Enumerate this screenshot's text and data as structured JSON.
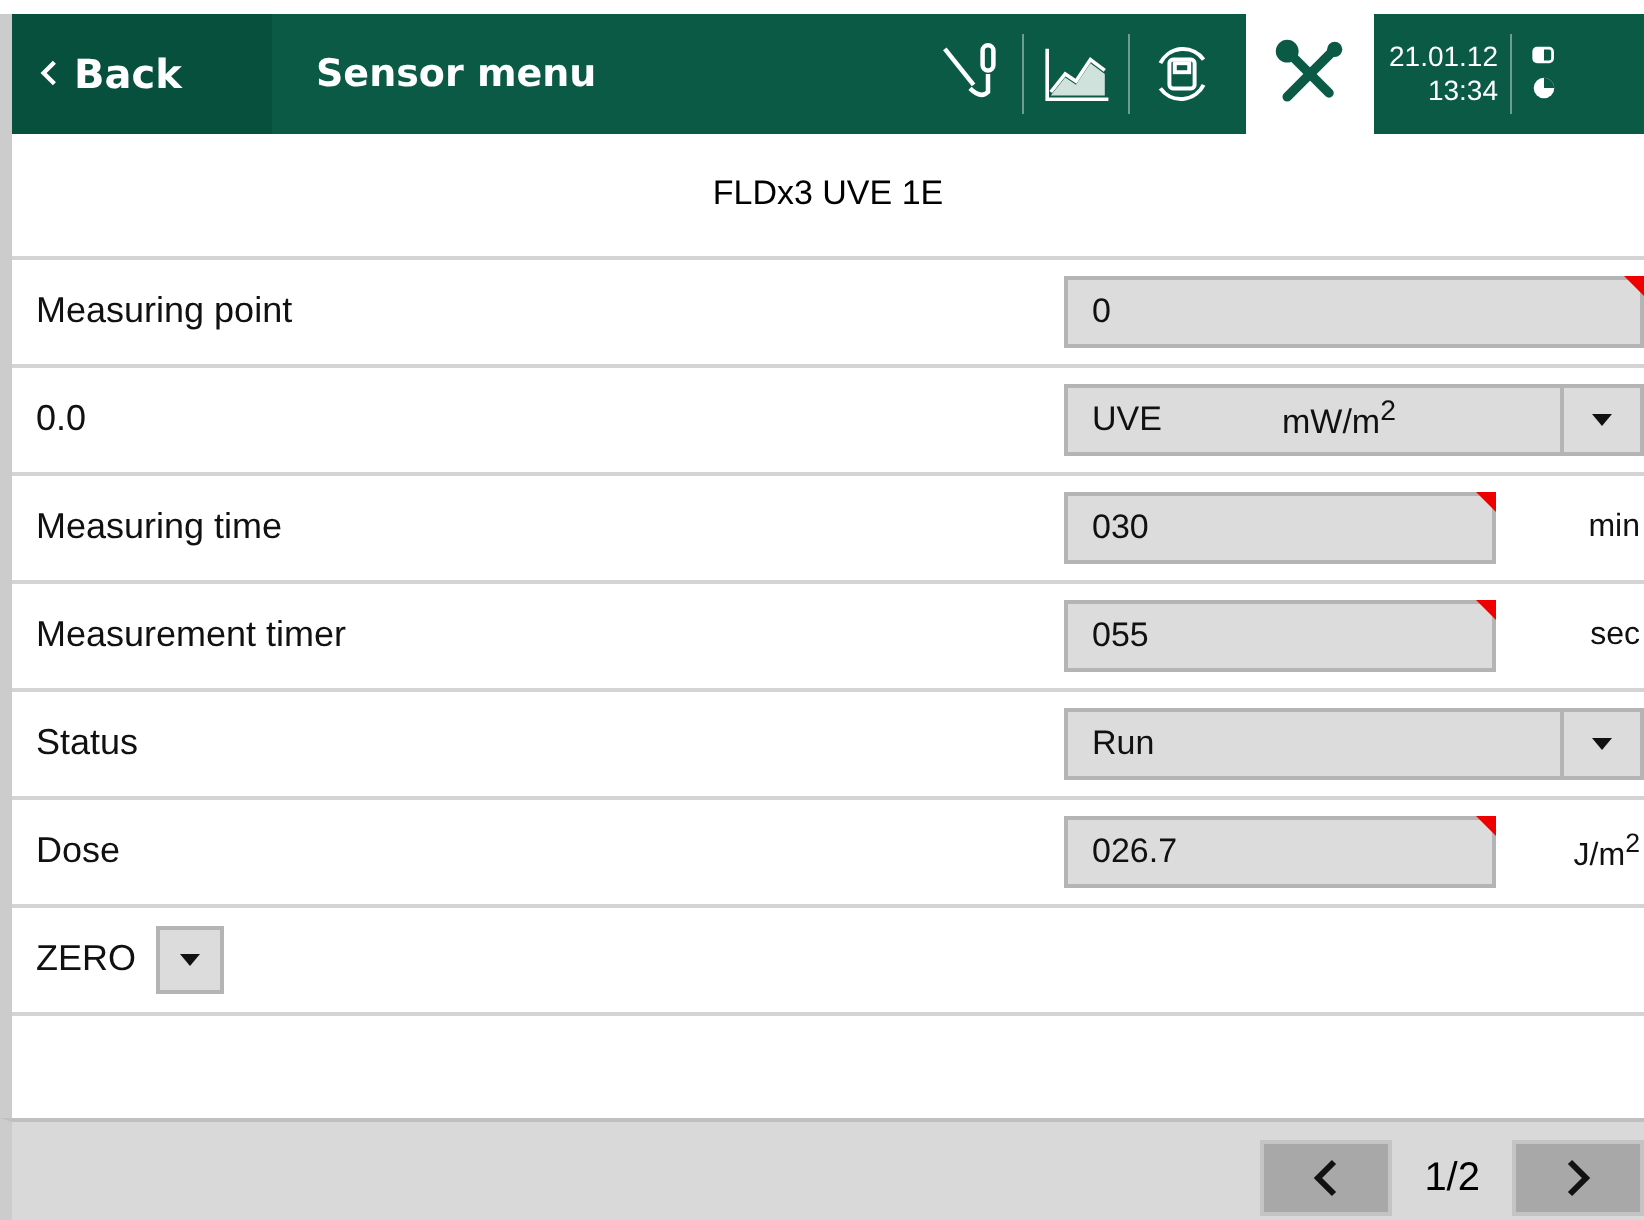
{
  "header": {
    "back": "Back",
    "title": "Sensor menu",
    "tools": [
      {
        "kind": "sensor",
        "selected": false
      },
      {
        "kind": "chart",
        "selected": false
      },
      {
        "kind": "save",
        "selected": false
      },
      {
        "kind": "tools",
        "selected": true
      }
    ],
    "date": "21.01.12",
    "time": "13:34"
  },
  "device": "FLDx3 UVE 1E",
  "rows": [
    {
      "label": "Measuring point",
      "kind": "input",
      "value": "0"
    },
    {
      "label": "0.0",
      "kind": "select",
      "value": "UVE",
      "value_unit": "mW/m$^{2}$"
    },
    {
      "label": "Measuring time",
      "kind": "input",
      "value": "030",
      "unit": "min"
    },
    {
      "label": "Measurement timer",
      "kind": "input",
      "value": "055",
      "unit": "sec"
    },
    {
      "label": "Status",
      "kind": "select",
      "value": "Run"
    },
    {
      "label": "Dose",
      "kind": "input",
      "value": "026.7",
      "unit": "J/m$^{2}$"
    },
    {
      "label": "ZERO",
      "kind": "dropbutton"
    }
  ],
  "pager": {
    "page": "1/2"
  }
}
